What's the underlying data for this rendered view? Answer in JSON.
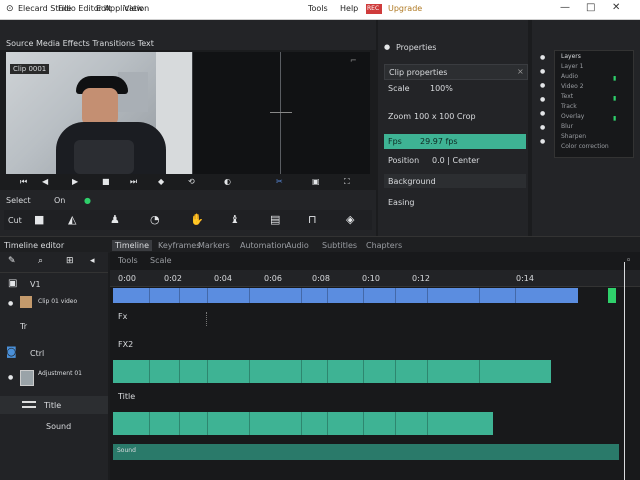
{
  "titlebar": {
    "title": "Elecard Studio Editor Application",
    "items": [
      "File",
      "Edit",
      "View",
      "Tools",
      "Help"
    ],
    "badge": "REC",
    "extra": "Upgrade",
    "win_buttons": [
      "—",
      "□",
      "✕"
    ]
  },
  "source_panel": {
    "header": "Source  Media  Effects  Transitions  Text",
    "clip_label": "Clip 0001",
    "controls": [
      "⏮",
      "◀",
      "▶",
      "■",
      "⏭",
      "◆",
      "⟲",
      "◐",
      "✂",
      "▣",
      "⛶",
      "▶",
      "⏵",
      "◉",
      "▲"
    ]
  },
  "toolbar": {
    "left_label": "Select",
    "left_value": "On",
    "tools": [
      "Cut",
      "Trim",
      "Slip",
      "Zoom",
      "Add",
      "Lock",
      "Eye"
    ]
  },
  "properties": {
    "title": "Properties",
    "section": "Clip properties",
    "rows": [
      {
        "label": "Scale",
        "value": "100%"
      },
      {
        "label": "Zoom",
        "value": "100 x 100 Crop"
      },
      {
        "label": "Fps",
        "value": "29.97 fps"
      },
      {
        "label": "Position",
        "value": "0.0 | Center"
      },
      {
        "label": "Background",
        "value": ""
      },
      {
        "label": "Easing",
        "value": ""
      }
    ],
    "selected_index": 2
  },
  "layers": {
    "title": "Layers",
    "items": [
      "Layer 1",
      "Audio",
      "Video 2",
      "Text",
      "Track",
      "Overlay",
      "Blur",
      "Sharpen",
      "Color correction"
    ]
  },
  "timeline": {
    "title": "Timeline editor",
    "tabs": [
      "Timeline",
      "Keyframes",
      "Markers",
      "Automation",
      "Audio",
      "Subtitles",
      "Chapters"
    ],
    "subtabs": [
      "Tools",
      "Scale"
    ],
    "ruler": [
      "0:00",
      "0:02",
      "0:04",
      "0:06",
      "0:08",
      "0:10",
      "0:12",
      "0:14"
    ],
    "track_labels": [
      "V1",
      "Tr",
      "Ctrl",
      "Fx",
      "FX2"
    ],
    "tracks": [
      {
        "name": "Video clip",
        "label": "Clip 01 video"
      },
      {
        "name": "Adjustment",
        "label": "Adjustment 01"
      },
      {
        "name": "Title",
        "label": "Title"
      },
      {
        "name": "Sound",
        "label": "Sound"
      }
    ]
  },
  "colors": {
    "teal": "#3eb394",
    "blue": "#5b8de0",
    "green": "#2fd06b",
    "bar": "#2a7a6a"
  }
}
